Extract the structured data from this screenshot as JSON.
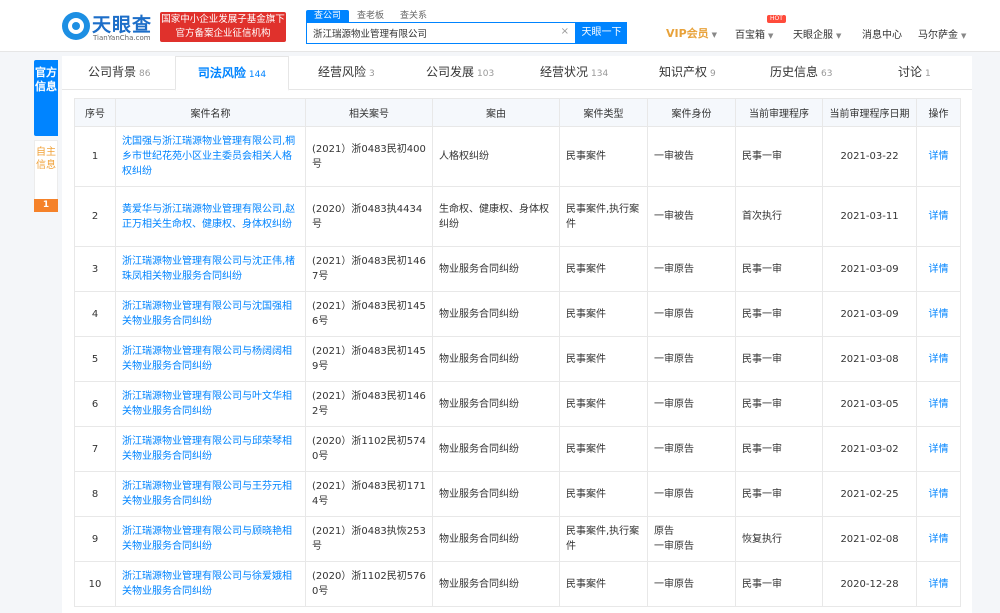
{
  "header": {
    "logo_name": "天眼查",
    "logo_sub": "TianYanCha.com",
    "gov_badge_line1": "国家中小企业发展子基金旗下",
    "gov_badge_line2": "官方备案企业征信机构",
    "search_tabs": [
      "查公司",
      "查老板",
      "查关系"
    ],
    "search_value": "浙江瑞源物业管理有限公司",
    "search_clear": "×",
    "search_button": "天眼一下",
    "vip_label": "VIP会员",
    "hot_badge": "HOT",
    "nav_items": [
      "百宝箱",
      "天眼企服",
      "消息中心",
      "马尔萨金"
    ]
  },
  "side": {
    "official_label": "官方信息",
    "self_label": "自主信息",
    "self_count": "1"
  },
  "tabs": [
    {
      "label": "公司背景",
      "count": "86"
    },
    {
      "label": "司法风险",
      "count": "144"
    },
    {
      "label": "经营风险",
      "count": "3"
    },
    {
      "label": "公司发展",
      "count": "103"
    },
    {
      "label": "经营状况",
      "count": "134"
    },
    {
      "label": "知识产权",
      "count": "9"
    },
    {
      "label": "历史信息",
      "count": "63"
    },
    {
      "label": "讨论",
      "count": "1"
    }
  ],
  "table": {
    "headers": [
      "序号",
      "案件名称",
      "相关案号",
      "案由",
      "案件类型",
      "案件身份",
      "当前审理程序",
      "当前审理程序日期",
      "操作"
    ],
    "rows": [
      {
        "no": "1",
        "name": "沈国强与浙江瑞源物业管理有限公司,桐乡市世纪花苑小区业主委员会相关人格权纠纷",
        "case_no": "(2021）浙0483民初400号",
        "cause": "人格权纠纷",
        "type": "民事案件",
        "role": "一审被告",
        "stage": "民事一审",
        "date": "2021-03-22",
        "op": "详情"
      },
      {
        "no": "2",
        "name": "黄爱华与浙江瑞源物业管理有限公司,赵正万相关生命权、健康权、身体权纠纷",
        "case_no": "(2020）浙0483执4434号",
        "cause": "生命权、健康权、身体权纠纷",
        "type": "民事案件,执行案件",
        "role": "一审被告",
        "stage": "首次执行",
        "date": "2021-03-11",
        "op": "详情"
      },
      {
        "no": "3",
        "name": "浙江瑞源物业管理有限公司与沈正伟,楮珠凤相关物业服务合同纠纷",
        "case_no": "(2021）浙0483民初1467号",
        "cause": "物业服务合同纠纷",
        "type": "民事案件",
        "role": "一审原告",
        "stage": "民事一审",
        "date": "2021-03-09",
        "op": "详情"
      },
      {
        "no": "4",
        "name": "浙江瑞源物业管理有限公司与沈国强相关物业服务合同纠纷",
        "case_no": "(2021）浙0483民初1456号",
        "cause": "物业服务合同纠纷",
        "type": "民事案件",
        "role": "一审原告",
        "stage": "民事一审",
        "date": "2021-03-09",
        "op": "详情"
      },
      {
        "no": "5",
        "name": "浙江瑞源物业管理有限公司与杨阔阔相关物业服务合同纠纷",
        "case_no": "(2021）浙0483民初1459号",
        "cause": "物业服务合同纠纷",
        "type": "民事案件",
        "role": "一审原告",
        "stage": "民事一审",
        "date": "2021-03-08",
        "op": "详情"
      },
      {
        "no": "6",
        "name": "浙江瑞源物业管理有限公司与叶文华相关物业服务合同纠纷",
        "case_no": "(2021）浙0483民初1462号",
        "cause": "物业服务合同纠纷",
        "type": "民事案件",
        "role": "一审原告",
        "stage": "民事一审",
        "date": "2021-03-05",
        "op": "详情"
      },
      {
        "no": "7",
        "name": "浙江瑞源物业管理有限公司与邱荣琴相关物业服务合同纠纷",
        "case_no": "(2020）浙1102民初5740号",
        "cause": "物业服务合同纠纷",
        "type": "民事案件",
        "role": "一审原告",
        "stage": "民事一审",
        "date": "2021-03-02",
        "op": "详情"
      },
      {
        "no": "8",
        "name": "浙江瑞源物业管理有限公司与王芬元相关物业服务合同纠纷",
        "case_no": "(2021）浙0483民初1714号",
        "cause": "物业服务合同纠纷",
        "type": "民事案件",
        "role": "一审原告",
        "stage": "民事一审",
        "date": "2021-02-25",
        "op": "详情"
      },
      {
        "no": "9",
        "name": "浙江瑞源物业管理有限公司与顾晓艳相关物业服务合同纠纷",
        "case_no": "(2021）浙0483执恢253号",
        "cause": "物业服务合同纠纷",
        "type": "民事案件,执行案件",
        "role": "原告\n一审原告",
        "stage": "恢复执行",
        "date": "2021-02-08",
        "op": "详情"
      },
      {
        "no": "10",
        "name": "浙江瑞源物业管理有限公司与徐爱娥相关物业服务合同纠纷",
        "case_no": "(2020）浙1102民初5760号",
        "cause": "物业服务合同纠纷",
        "type": "民事案件",
        "role": "一审原告",
        "stage": "民事一审",
        "date": "2020-12-28",
        "op": "详情"
      }
    ]
  }
}
